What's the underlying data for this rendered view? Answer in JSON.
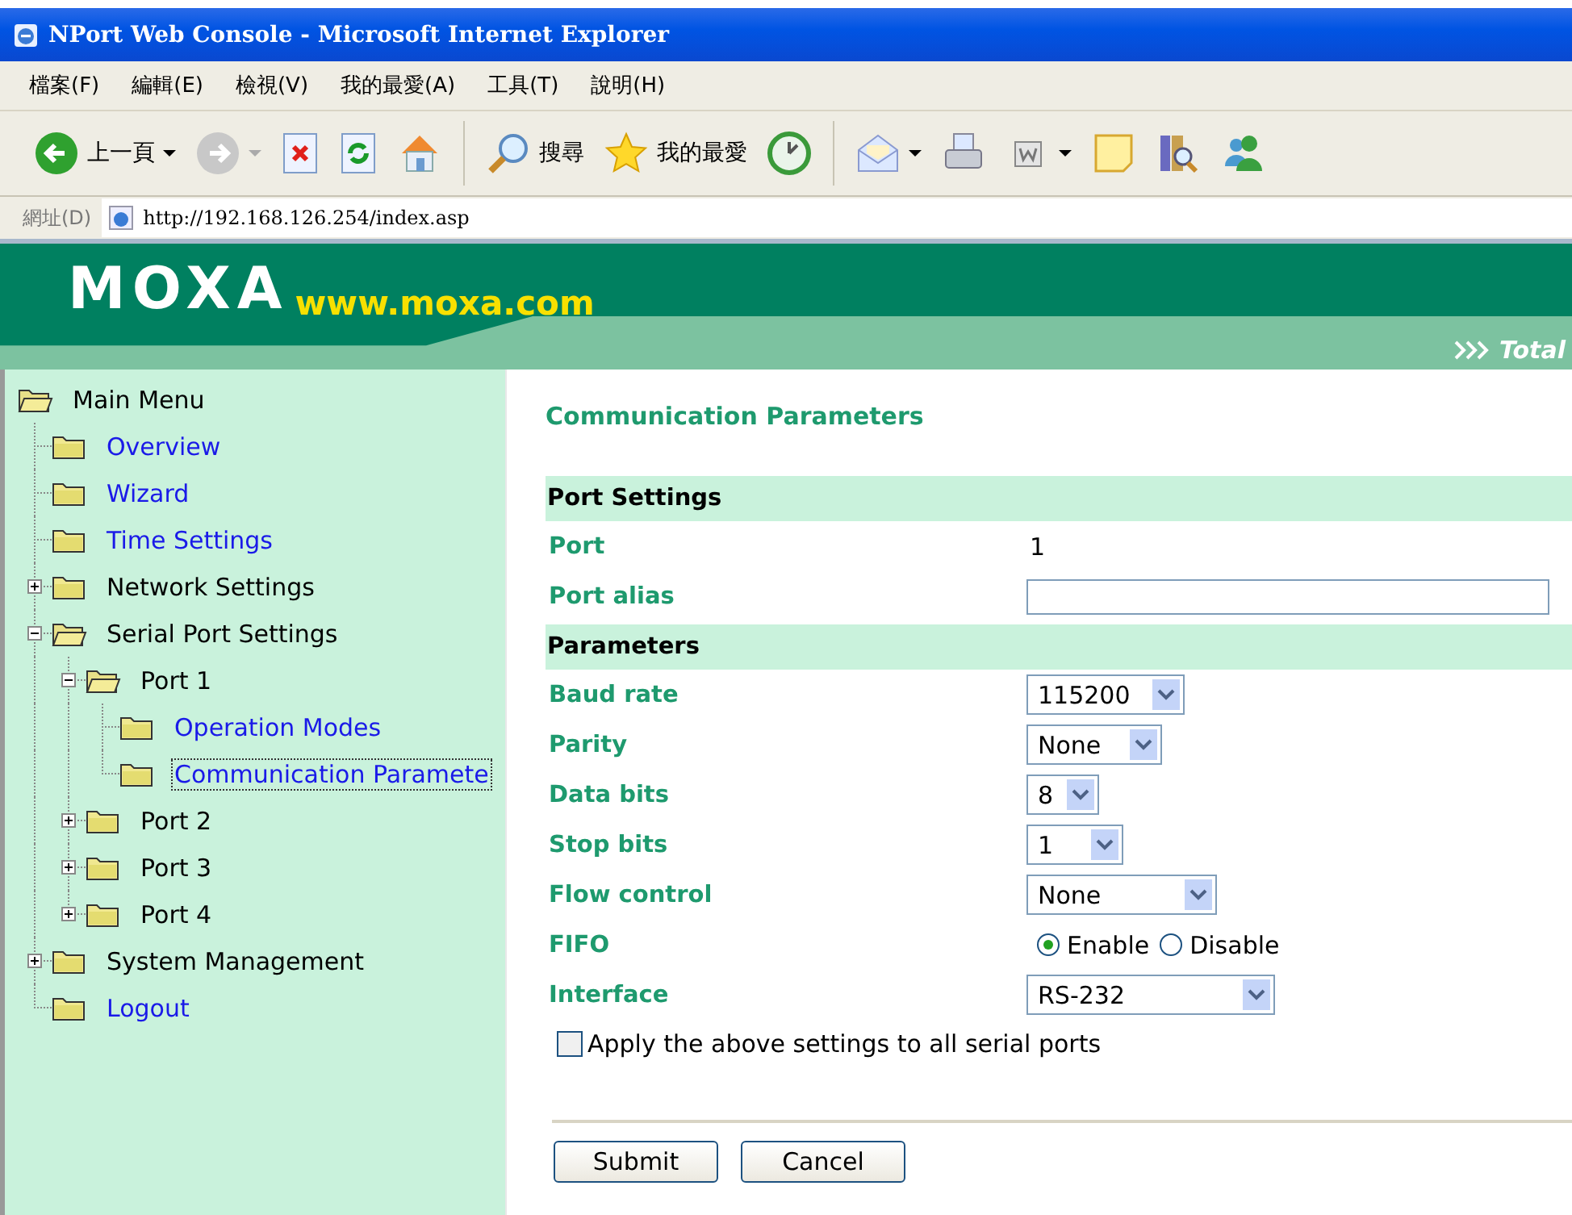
{
  "window": {
    "title": "NPort Web Console - Microsoft Internet Explorer"
  },
  "menu_bar": [
    "檔案(F)",
    "編輯(E)",
    "檢視(V)",
    "我的最愛(A)",
    "工具(T)",
    "說明(H)"
  ],
  "toolbar": [
    {
      "kind": "back",
      "label": "上一頁",
      "dropdown": true
    },
    {
      "kind": "forward",
      "dropdown": true
    },
    {
      "kind": "stop",
      "dropdown": false
    },
    {
      "kind": "refresh",
      "dropdown": false
    },
    {
      "kind": "home",
      "dropdown": false
    },
    {
      "kind": "separator"
    },
    {
      "kind": "search",
      "label": "搜尋",
      "dropdown": false
    },
    {
      "kind": "favorites",
      "label": "我的最愛",
      "dropdown": false
    },
    {
      "kind": "history",
      "dropdown": false
    },
    {
      "kind": "separator"
    },
    {
      "kind": "mail",
      "dropdown": true
    },
    {
      "kind": "print",
      "dropdown": false
    },
    {
      "kind": "edit",
      "dropdown": true
    },
    {
      "kind": "note",
      "dropdown": false
    },
    {
      "kind": "research",
      "dropdown": false
    },
    {
      "kind": "messenger",
      "dropdown": false
    }
  ],
  "address_bar": {
    "label": "網址(D)",
    "url": "http://192.168.126.254/index.asp"
  },
  "banner": {
    "logo": "MOXA",
    "site": "www.moxa.com",
    "tagline": "Total"
  },
  "sidebar": {
    "tree": {
      "label": "Main Menu",
      "link": false,
      "selected": false,
      "children": [
        {
          "label": "Overview",
          "link": true,
          "selected": false
        },
        {
          "label": "Wizard",
          "link": true,
          "selected": false
        },
        {
          "label": "Time Settings",
          "link": true,
          "selected": false
        },
        {
          "label": "Network Settings",
          "link": false,
          "selected": false,
          "expanded": false
        },
        {
          "label": "Serial Port Settings",
          "link": false,
          "selected": false,
          "expanded": true,
          "children": [
            {
              "label": "Port 1",
              "link": false,
              "selected": false,
              "expanded": true,
              "children": [
                {
                  "label": "Operation Modes",
                  "link": true,
                  "selected": false
                },
                {
                  "label": "Communication Paramete",
                  "link": true,
                  "selected": true
                }
              ]
            },
            {
              "label": "Port 2",
              "link": false,
              "selected": false,
              "expanded": false
            },
            {
              "label": "Port 3",
              "link": false,
              "selected": false,
              "expanded": false
            },
            {
              "label": "Port 4",
              "link": false,
              "selected": false,
              "expanded": false
            }
          ]
        },
        {
          "label": "System Management",
          "link": false,
          "selected": false,
          "expanded": false
        },
        {
          "label": "Logout",
          "link": true,
          "selected": false
        }
      ]
    }
  },
  "content": {
    "title": "Communication Parameters",
    "sections": [
      {
        "title": "Port Settings",
        "rows": [
          {
            "kind": "value",
            "label": "Port",
            "value": "1"
          },
          {
            "kind": "text",
            "label": "Port alias"
          }
        ]
      },
      {
        "title": "Parameters",
        "rows": [
          {
            "kind": "select",
            "label": "Baud rate",
            "value": "115200"
          },
          {
            "kind": "select",
            "label": "Parity",
            "value": "None"
          },
          {
            "kind": "select",
            "label": "Data bits",
            "value": "8"
          },
          {
            "kind": "select",
            "label": "Stop bits",
            "value": "1"
          },
          {
            "kind": "select",
            "label": "Flow control",
            "value": "None"
          },
          {
            "kind": "radio",
            "label": "FIFO",
            "options": [
              {
                "label": "Enable",
                "selected": true
              },
              {
                "label": "Disable",
                "selected": false
              }
            ]
          },
          {
            "kind": "select",
            "label": "Interface",
            "value": "RS-232"
          }
        ]
      }
    ],
    "apply_all": {
      "label": "Apply the above settings to all serial ports",
      "checked": false
    },
    "buttons": [
      "Submit",
      "Cancel"
    ]
  }
}
